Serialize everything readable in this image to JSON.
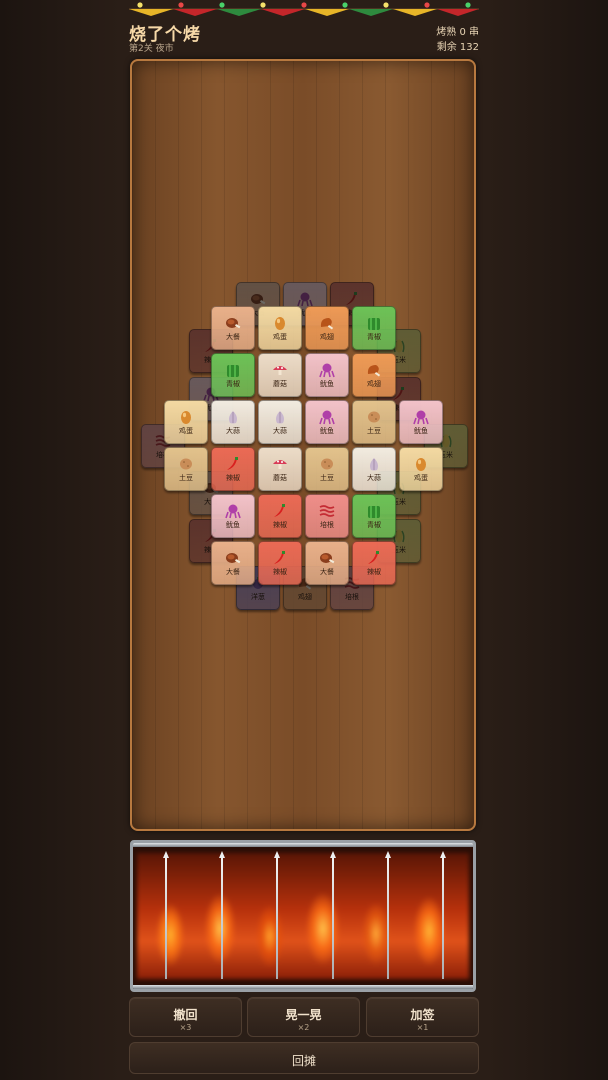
{
  "header": {
    "title": "烧了个烤",
    "level": "第2关 夜市",
    "cooked": "烤熟 0 串",
    "remaining": "剩余 132"
  },
  "tile_types": {
    "drumstick": {
      "label": "大餐",
      "bg": "#e8b08a",
      "icon": "meat-drumstick-icon"
    },
    "egg": {
      "label": "鸡蛋",
      "bg": "#f3d9a2",
      "icon": "egg-icon"
    },
    "wing": {
      "label": "鸡翅",
      "bg": "#ee9a56",
      "icon": "chicken-wing-icon"
    },
    "pepper": {
      "label": "青椒",
      "bg": "#6cc257",
      "icon": "green-pepper-icon"
    },
    "mushroom": {
      "label": "蘑菇",
      "bg": "#ecdcc8",
      "icon": "mushroom-icon"
    },
    "squid": {
      "label": "鱿鱼",
      "bg": "#f2c2c9",
      "icon": "squid-icon"
    },
    "garlic": {
      "label": "大蒜",
      "bg": "#f1ebe0",
      "icon": "garlic-icon"
    },
    "potato": {
      "label": "土豆",
      "bg": "#e2c28c",
      "icon": "potato-icon"
    },
    "chili": {
      "label": "辣椒",
      "bg": "#ea6a55",
      "icon": "chili-icon"
    },
    "bacon": {
      "label": "培根",
      "bg": "#ef8e8a",
      "icon": "bacon-icon"
    },
    "onion": {
      "label": "洋葱",
      "bg": "#a98ad0",
      "icon": "onion-icon"
    },
    "corn": {
      "label": "玉米",
      "bg": "#d8cf52",
      "icon": "corn-icon"
    }
  },
  "top_tiles": [
    [
      "drumstick",
      "egg",
      "wing",
      "pepper"
    ],
    [
      "pepper",
      "mushroom",
      "squid",
      "wing"
    ],
    [
      "egg",
      "garlic",
      "garlic",
      "squid",
      "potato",
      "squid"
    ],
    [
      "potato",
      "chili",
      "mushroom",
      "potato",
      "garlic",
      "egg"
    ],
    [
      "squid",
      "chili",
      "bacon",
      "pepper"
    ],
    [
      "drumstick",
      "chili",
      "drumstick",
      "chili"
    ]
  ],
  "buried_tiles": [
    "drumstick",
    "squid",
    "chili",
    "chili",
    "corn",
    "squid",
    "chili",
    "bacon",
    "corn",
    "drumstick",
    "corn",
    "chili",
    "corn",
    "onion",
    "wing",
    "bacon"
  ],
  "buttons": [
    {
      "label": "撤回",
      "count": "×3"
    },
    {
      "label": "晃一晃",
      "count": "×2"
    },
    {
      "label": "加签",
      "count": "×1"
    }
  ],
  "return_button": "回摊",
  "colors": {
    "accent": "#f7d9a8",
    "board_border": "#b8793f",
    "button_bg": "#2c2019"
  }
}
